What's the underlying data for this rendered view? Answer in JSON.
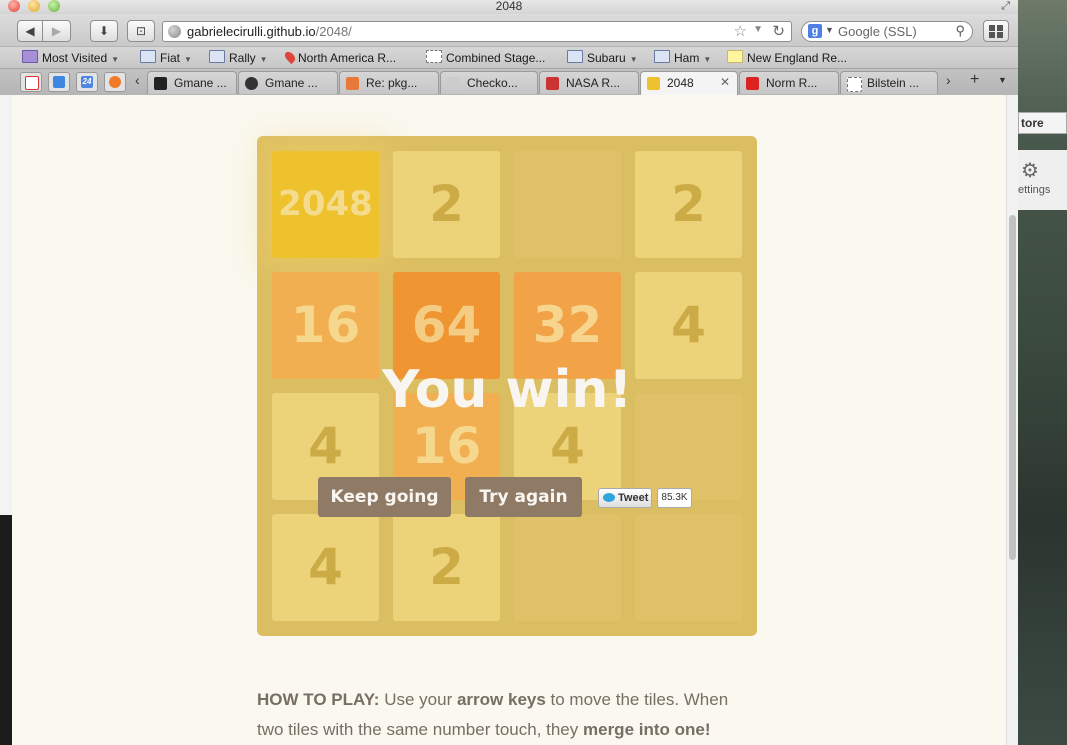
{
  "window": {
    "title": "2048",
    "url_host": "gabrielecirulli.github.io",
    "url_path": "/2048/",
    "search_placeholder": "Google (SSL)"
  },
  "bookmarks": [
    {
      "label": "Most Visited",
      "icon": "most-visited-icon",
      "menu": true
    },
    {
      "label": "Fiat",
      "icon": "folder-icon",
      "menu": true
    },
    {
      "label": "Rally",
      "icon": "folder-icon",
      "menu": true
    },
    {
      "label": "North America R...",
      "icon": "map-pin-icon",
      "menu": false
    },
    {
      "label": "Combined Stage...",
      "icon": "page-icon",
      "menu": false
    },
    {
      "label": "Subaru",
      "icon": "folder-icon",
      "menu": true
    },
    {
      "label": "Ham",
      "icon": "folder-icon",
      "menu": true
    },
    {
      "label": "New England Re...",
      "icon": "flag-icon",
      "menu": false
    }
  ],
  "tabs": [
    {
      "label": "Gmane ...",
      "active": false
    },
    {
      "label": "Gmane ...",
      "active": false
    },
    {
      "label": "Re: pkg...",
      "active": false
    },
    {
      "label": "Checko...",
      "active": false
    },
    {
      "label": "NASA R...",
      "active": false
    },
    {
      "label": "2048",
      "active": true
    },
    {
      "label": "Norm R...",
      "active": false
    },
    {
      "label": "Bilstein ...",
      "active": false
    }
  ],
  "app_tabs": [
    "gmail-icon",
    "phone-icon",
    "calendar-icon",
    "orange-circle-icon"
  ],
  "calendar_day": "24",
  "desktop": {
    "store_label": "tore",
    "settings_label": "ettings"
  },
  "game": {
    "board": [
      [
        "2048",
        "2",
        "",
        "2"
      ],
      [
        "16",
        "64",
        "32",
        "4"
      ],
      [
        "4",
        "16",
        "4",
        ""
      ],
      [
        "4",
        "2",
        "",
        ""
      ]
    ],
    "message": "You win!",
    "keep_going_label": "Keep going",
    "try_again_label": "Try again",
    "tweet_label": "Tweet",
    "tweet_count": "85.3K"
  },
  "howto": {
    "heading": "HOW TO PLAY:",
    "p1": " Use your ",
    "keys": "arrow keys",
    "p2": " to move the tiles. When two tiles with the same number touch, they ",
    "merge": "merge into one!"
  },
  "colors": {
    "board": "#d8be6e",
    "page_bg": "#faf8ef",
    "button": "#8f7a66",
    "tile_2048": "#edc22e"
  }
}
